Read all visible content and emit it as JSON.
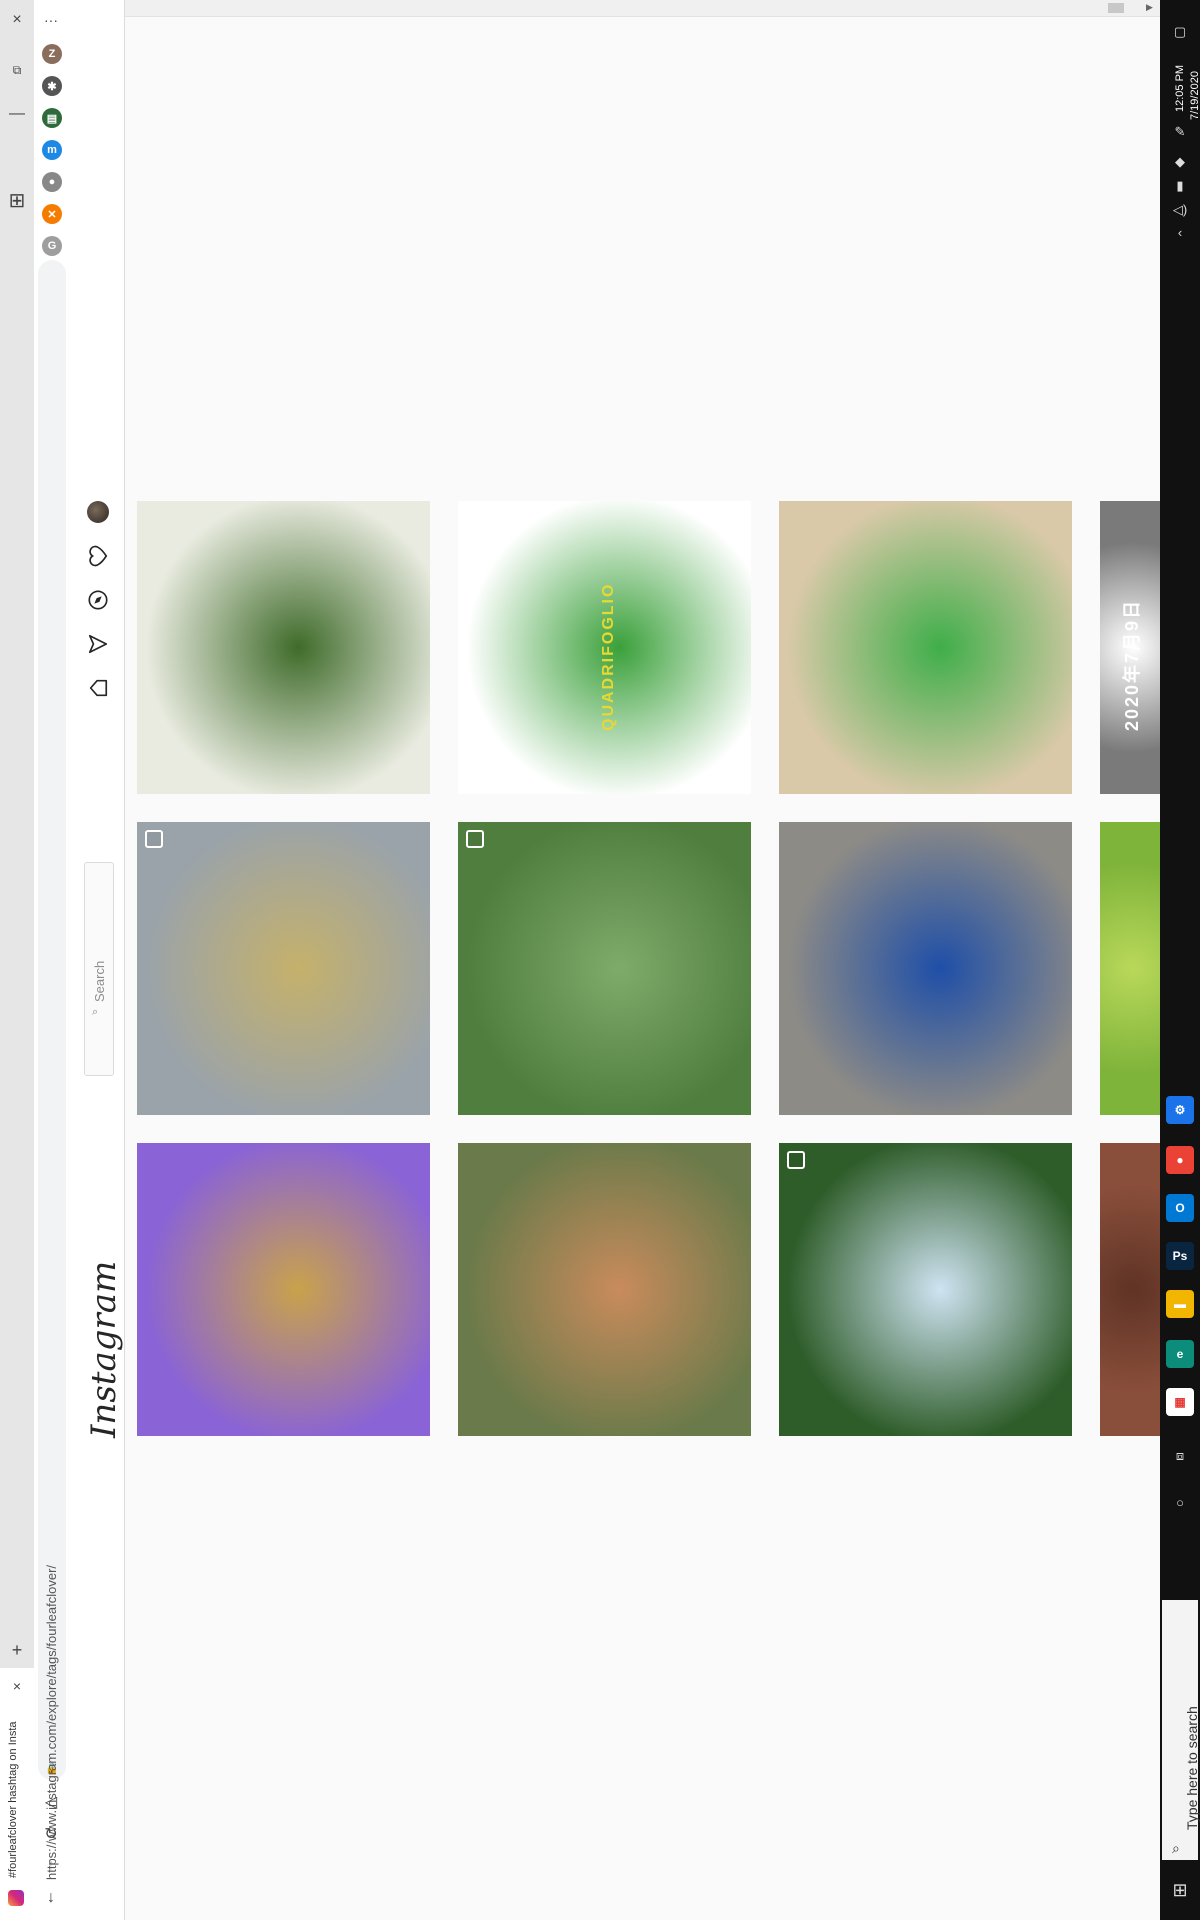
{
  "browser": {
    "tab_title": "#fourleafclover hashtag on Insta",
    "url": "https://www.instagram.com/explore/tags/fourleafclover/",
    "new_tab_symbol": "+",
    "close_tab_symbol": "×",
    "menu_symbol": "···",
    "extensions": [
      {
        "name": "profile",
        "letter": "Z",
        "color": "#8a6d5c"
      },
      {
        "name": "puzzle",
        "letter": "✱",
        "color": "#555555"
      },
      {
        "name": "ext-landscape",
        "letter": "▤",
        "color": "#2e6b3a"
      },
      {
        "name": "ext-blue",
        "letter": "m",
        "color": "#1e88e5"
      },
      {
        "name": "ext-grey",
        "letter": "●",
        "color": "#888888"
      },
      {
        "name": "ext-orange",
        "letter": "✕",
        "color": "#f57c00"
      },
      {
        "name": "ext-g",
        "letter": "G",
        "color": "#9e9e9e"
      }
    ]
  },
  "instagram": {
    "logo": "Instagram",
    "search_placeholder": "Search"
  },
  "grid": {
    "tiles": [
      {
        "desc": "four-leaf clovers on paper",
        "bg": "#e9ebe0",
        "accent": "#3f6b2a",
        "multi": false
      },
      {
        "desc": "QUADRIFOGLIO clover logo",
        "bg": "#ffffff",
        "accent": "#3aa03a",
        "multi": false,
        "text": "QUADRIFOGLIO"
      },
      {
        "desc": "clovers on path",
        "bg": "#d9c9a8",
        "accent": "#3fae49",
        "multi": false
      },
      {
        "desc": "japanese card",
        "bg": "#7a7a7a",
        "accent": "#ffffff",
        "multi": false,
        "text": "2020年7月9日"
      },
      {
        "desc": "person in mask",
        "bg": "#9aa3aa",
        "accent": "#c5b16b",
        "multi": true
      },
      {
        "desc": "clover leaves",
        "bg": "#4f7e3f",
        "accent": "#7fab6a",
        "multi": true
      },
      {
        "desc": "garage lifts",
        "bg": "#8d8b86",
        "accent": "#1f4fa8",
        "multi": false
      },
      {
        "desc": "green leaves",
        "bg": "#7fb43a",
        "accent": "#b9d85a",
        "multi": false
      },
      {
        "desc": "resin keychains",
        "bg": "#8a63d6",
        "accent": "#c9a24b",
        "multi": false
      },
      {
        "desc": "dog with clover",
        "bg": "#6b7a4a",
        "accent": "#c98b5c",
        "multi": false
      },
      {
        "desc": "waterfall",
        "bg": "#2f5d2a",
        "accent": "#cfe3f2",
        "multi": true
      },
      {
        "desc": "wood tones",
        "bg": "#8a4f3b",
        "accent": "#5f3325",
        "multi": false
      }
    ]
  },
  "taskbar": {
    "time": "12:05 PM",
    "date": "7/19/2020",
    "search_placeholder": "Type here to search",
    "apps": [
      {
        "name": "settings",
        "letter": "⚙",
        "color": "#1a73e8"
      },
      {
        "name": "chrome",
        "letter": "●",
        "color": "#ea4335"
      },
      {
        "name": "outlook",
        "letter": "O",
        "color": "#0078d4"
      },
      {
        "name": "photoshop",
        "letter": "Ps",
        "color": "#0a2540"
      },
      {
        "name": "file-explorer",
        "letter": "▬",
        "color": "#f2b600"
      },
      {
        "name": "edge",
        "letter": "e",
        "color": "#0c8c7a"
      },
      {
        "name": "store",
        "letter": "▦",
        "color": "#ffffff"
      }
    ]
  }
}
